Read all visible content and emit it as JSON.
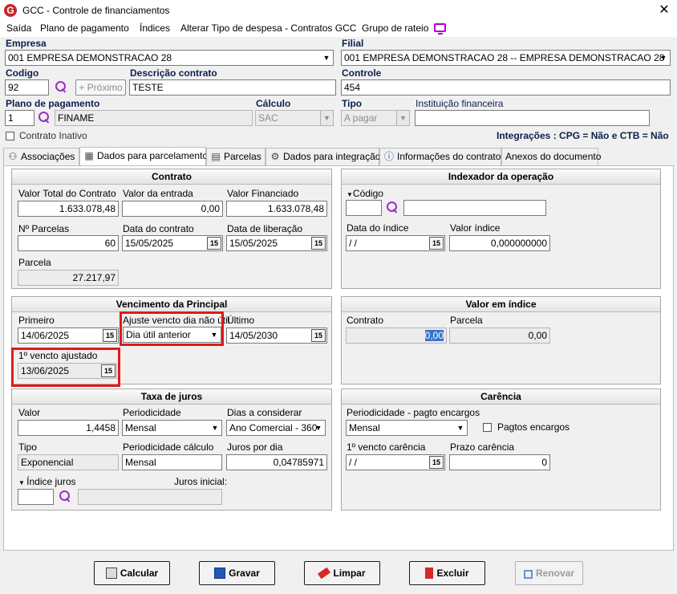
{
  "window": {
    "title": "GCC - Controle de financiamentos",
    "close_label": "✕"
  },
  "menu": [
    "Saída",
    "Plano de pagamento",
    "Índices",
    "Alterar Tipo de despesa - Contratos GCC",
    "Grupo de rateio"
  ],
  "header": {
    "empresa_label": "Empresa",
    "empresa_value": "001 EMPRESA DEMONSTRACAO 28",
    "filial_label": "Filial",
    "filial_value": "001 EMPRESA DEMONSTRACAO 28 -- EMPRESA DEMONSTRACAO 28",
    "codigo_label": "Codigo",
    "codigo_value": "92",
    "proximo_label": "+ Próximo",
    "descricao_label": "Descrição contrato",
    "descricao_value": "TESTE",
    "controle_label": "Controle",
    "controle_value": "454",
    "plano_label": "Plano de pagamento",
    "plano_code": "1",
    "plano_name": "FINAME",
    "calculo_label": "Cálculo",
    "calculo_value": "SAC",
    "tipo_label": "Tipo",
    "tipo_value": "A pagar",
    "instituicao_label": "Instituição financeira",
    "instituicao_value": "",
    "inativo_label": "Contrato Inativo",
    "integracoes": "Integrações : CPG = Não e CTB = Não"
  },
  "tabs": [
    "Associações",
    "Dados para parcelamento",
    "Parcelas",
    "Dados para integração",
    "Informações do contrato",
    "Anexos do documento"
  ],
  "contrato": {
    "title": "Contrato",
    "valor_total_label": "Valor Total do Contrato",
    "valor_total": "1.633.078,48",
    "valor_entrada_label": "Valor da entrada",
    "valor_entrada": "0,00",
    "valor_financiado_label": "Valor Financiado",
    "valor_financiado": "1.633.078,48",
    "nparcelas_label": "Nº Parcelas",
    "nparcelas": "60",
    "data_contrato_label": "Data do contrato",
    "data_contrato": "15/05/2025",
    "data_liberacao_label": "Data de liberação",
    "data_liberacao": "15/05/2025",
    "parcela_label": "Parcela",
    "parcela": "27.217,97"
  },
  "indexador": {
    "title": "Indexador da operação",
    "codigo_label": "Código",
    "codigo": "",
    "descricao": "",
    "data_indice_label": "Data do índice",
    "data_indice": " /  /",
    "valor_indice_label": "Valor índice",
    "valor_indice": "0,000000000"
  },
  "vencimento": {
    "title": "Vencimento da Principal",
    "primeiro_label": "Primeiro",
    "primeiro": "14/06/2025",
    "ajuste_label": "Ajuste vencto dia não útil",
    "ajuste": "Dia útil anterior",
    "ultimo_label": "Último",
    "ultimo": "14/05/2030",
    "ajustado_label": "1º vencto ajustado",
    "ajustado": "13/06/2025"
  },
  "valor_indice_panel": {
    "title": "Valor em índice",
    "contrato_label": "Contrato",
    "contrato": "0,00",
    "parcela_label": "Parcela",
    "parcela": "0,00"
  },
  "juros": {
    "title": "Taxa de juros",
    "valor_label": "Valor",
    "valor": "1,4458",
    "periodicidade_label": "Periodicidade",
    "periodicidade": "Mensal",
    "dias_label": "Dias a considerar",
    "dias": "Ano Comercial - 360",
    "tipo_label": "Tipo",
    "tipo": "Exponencial",
    "period_calc_label": "Periodicidade cálculo",
    "period_calc": "Mensal",
    "juros_dia_label": "Juros por dia",
    "juros_dia": "0,04785971",
    "indice_label": "Índice juros",
    "juros_inicial_label": "Juros inicial:"
  },
  "carencia": {
    "title": "Carência",
    "period_label": "Periodicidade - pagto encargos",
    "period": "Mensal",
    "pagtos_label": "Pagtos encargos",
    "vencto_label": "1º vencto carência",
    "vencto": " /  /",
    "prazo_label": "Prazo carência",
    "prazo": "0"
  },
  "calendar_glyph": "15",
  "buttons": {
    "calcular": "Calcular",
    "gravar": "Gravar",
    "limpar": "Limpar",
    "excluir": "Excluir",
    "renovar": "Renovar"
  }
}
